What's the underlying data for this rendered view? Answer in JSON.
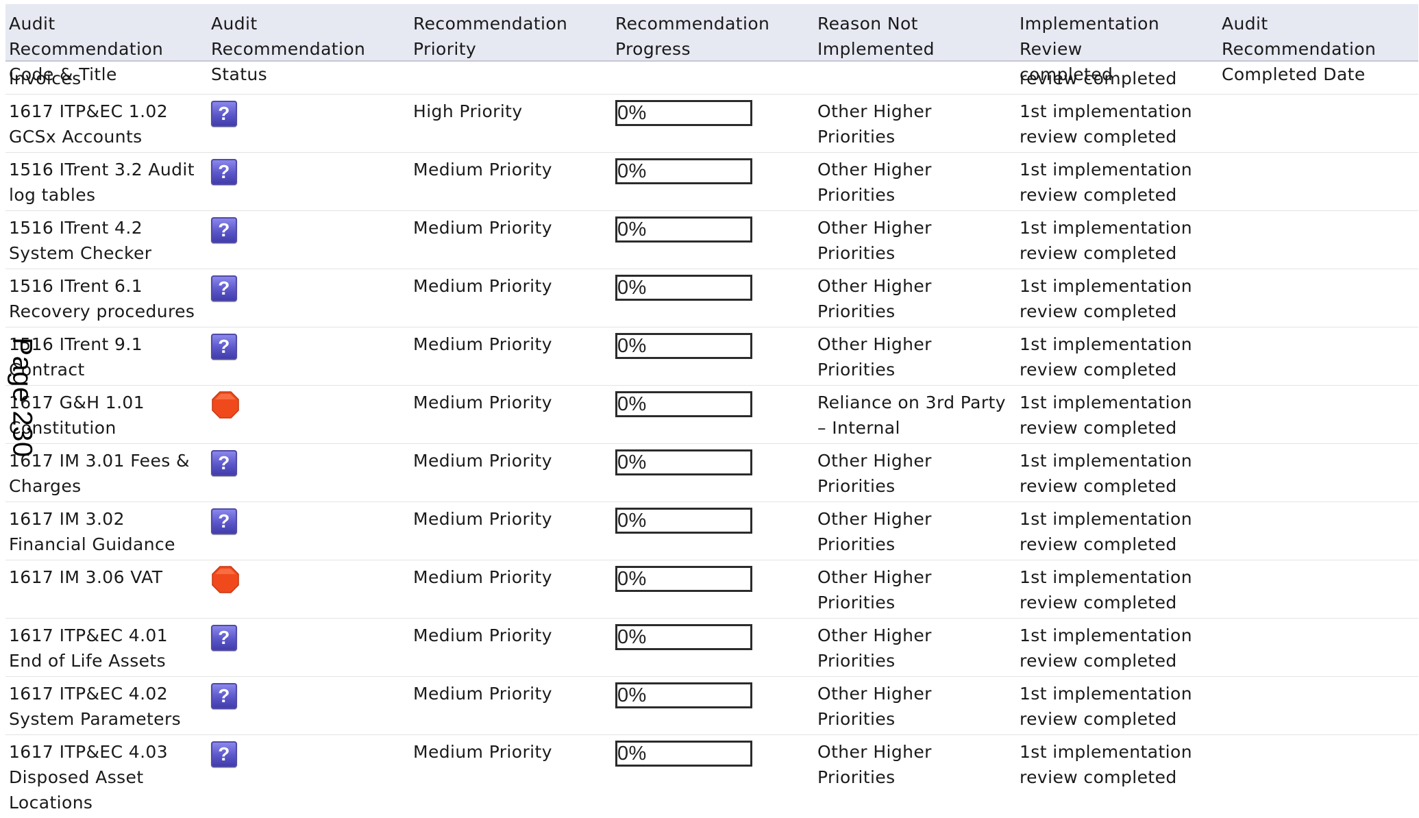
{
  "table": {
    "headers": [
      "Audit Recommendation\nCode & Title",
      "Audit Recommendation\nStatus",
      "Recommendation\nPriority",
      "Recommendation\nProgress",
      "Reason Not\nImplemented",
      " Implementation Review\ncompleted",
      "Audit Recommendation\nCompleted Date"
    ],
    "continuation_row": {
      "code_title": "Invoices",
      "review": "review completed"
    },
    "rows": [
      {
        "code_title": "1617 ITP&EC 1.02 GCSx Accounts",
        "status_icon": "question-mark-icon",
        "priority": "High Priority",
        "progress": "0%",
        "reason": "Other Higher Priorities",
        "review": "1st implementation review completed",
        "completed_date": ""
      },
      {
        "code_title": "1516 ITrent 3.2 Audit log tables",
        "status_icon": "question-mark-icon",
        "priority": "Medium Priority",
        "progress": "0%",
        "reason": "Other Higher Priorities",
        "review": "1st implementation review completed",
        "completed_date": ""
      },
      {
        "code_title": "1516 ITrent 4.2 System Checker",
        "status_icon": "question-mark-icon",
        "priority": "Medium Priority",
        "progress": "0%",
        "reason": "Other Higher Priorities",
        "review": "1st implementation review completed",
        "completed_date": ""
      },
      {
        "code_title": "1516 ITrent 6.1 Recovery procedures",
        "status_icon": "question-mark-icon",
        "priority": "Medium Priority",
        "progress": "0%",
        "reason": "Other Higher Priorities",
        "review": "1st implementation review completed",
        "completed_date": ""
      },
      {
        "code_title": "1516 ITrent 9.1 Contract",
        "status_icon": "question-mark-icon",
        "priority": "Medium Priority",
        "progress": "0%",
        "reason": "Other Higher Priorities",
        "review": "1st implementation review completed",
        "completed_date": ""
      },
      {
        "code_title": "1617 G&H 1.01 Constitution",
        "status_icon": "red-stop-icon",
        "priority": "Medium Priority",
        "progress": "0%",
        "reason": "Reliance on 3rd Party – Internal",
        "review": "1st implementation review completed",
        "completed_date": ""
      },
      {
        "code_title": "1617 IM 3.01 Fees & Charges",
        "status_icon": "question-mark-icon",
        "priority": "Medium Priority",
        "progress": "0%",
        "reason": "Other Higher Priorities",
        "review": "1st implementation review completed",
        "completed_date": ""
      },
      {
        "code_title": "1617 IM 3.02 Financial Guidance",
        "status_icon": "question-mark-icon",
        "priority": "Medium Priority",
        "progress": "0%",
        "reason": "Other Higher Priorities",
        "review": "1st implementation review completed",
        "completed_date": ""
      },
      {
        "code_title": "1617 IM 3.06 VAT",
        "status_icon": "red-stop-icon",
        "priority": "Medium Priority",
        "progress": "0%",
        "reason": "Other Higher Priorities",
        "review": "1st implementation review completed",
        "completed_date": ""
      },
      {
        "code_title": "1617 ITP&EC 4.01 End of Life Assets",
        "status_icon": "question-mark-icon",
        "priority": "Medium Priority",
        "progress": "0%",
        "reason": "Other Higher Priorities",
        "review": "1st implementation review completed",
        "completed_date": ""
      },
      {
        "code_title": "1617 ITP&EC 4.02 System Parameters",
        "status_icon": "question-mark-icon",
        "priority": "Medium Priority",
        "progress": "0%",
        "reason": "Other Higher Priorities",
        "review": "1st implementation review completed",
        "completed_date": ""
      },
      {
        "code_title": "1617 ITP&EC 4.03 Disposed Asset Locations",
        "status_icon": "question-mark-icon",
        "priority": "Medium Priority",
        "progress": "0%",
        "reason": "Other Higher Priorities",
        "review": "1st implementation review completed",
        "completed_date": ""
      }
    ]
  },
  "page_stamp": "Page 230",
  "colors": {
    "header_bg": "#e6e8f2",
    "question_icon": "#5b56c9",
    "stop_icon": "#f04a1c"
  }
}
